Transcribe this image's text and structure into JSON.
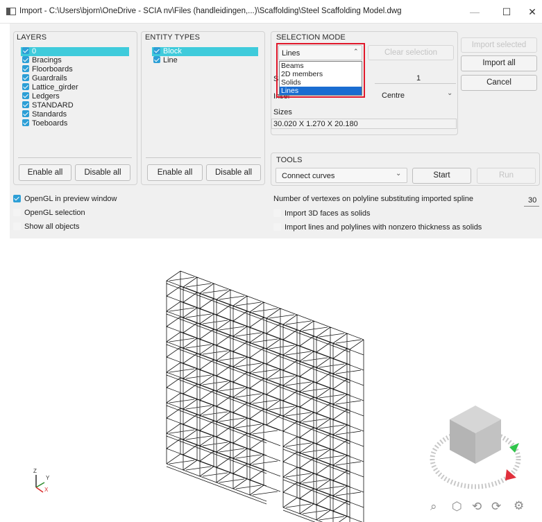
{
  "window": {
    "title": "Import - C:\\Users\\bjorn\\OneDrive - SCIA nv\\Files (handleidingen,...)\\Scaffolding\\Steel Scaffolding Model.dwg",
    "minimize": "—",
    "maximize": "☐",
    "close": "✕"
  },
  "layers": {
    "title": "LAYERS",
    "items": [
      "0",
      "Bracings",
      "Floorboards",
      "Guardrails",
      "Lattice_girder",
      "Ledgers",
      "STANDARD",
      "Standards",
      "Toeboards"
    ],
    "selected_index": 0,
    "enable_all": "Enable all",
    "disable_all": "Disable all"
  },
  "entity_types": {
    "title": "ENTITY TYPES",
    "items": [
      "Block",
      "Line"
    ],
    "selected_index": 0,
    "enable_all": "Enable all",
    "disable_all": "Disable all"
  },
  "selection_mode": {
    "title": "SELECTION MODE",
    "current": "Lines",
    "options": [
      "Beams",
      "2D members",
      "Solids",
      "Lines"
    ],
    "highlighted_option": "Lines",
    "clear_selection": "Clear selection",
    "scale_label_partial": "S",
    "scale_value": "1",
    "insertion_label_partial": "Inser",
    "insertion_value": "Centre",
    "sizes_label": "Sizes",
    "sizes_value": "30.020 X 1.270 X 20.180"
  },
  "actions": {
    "import_selected": "Import selected",
    "import_all": "Import all",
    "cancel": "Cancel"
  },
  "tools": {
    "title": "TOOLS",
    "current": "Connect curves",
    "start": "Start",
    "run": "Run"
  },
  "options_left": [
    {
      "label": "OpenGL in preview window",
      "checked": true
    },
    {
      "label": "OpenGL selection",
      "checked": false
    },
    {
      "label": "Show all objects",
      "checked": false
    }
  ],
  "options_right": {
    "vertex_label": "Number of vertexes on polyline substituting imported spline",
    "vertex_value": "30",
    "import_3d_faces": "Import 3D faces as solids",
    "import_lines_thickness": "Import lines and polylines with nonzero thickness as solids"
  },
  "axes": {
    "z": "Z",
    "y": "Y",
    "x": "X"
  },
  "colors": {
    "accent": "#2d9fd6",
    "selected_row": "#3fcbdb",
    "dropdown_highlight": "#1a6dd1",
    "annotation_box": "#e0182a"
  }
}
